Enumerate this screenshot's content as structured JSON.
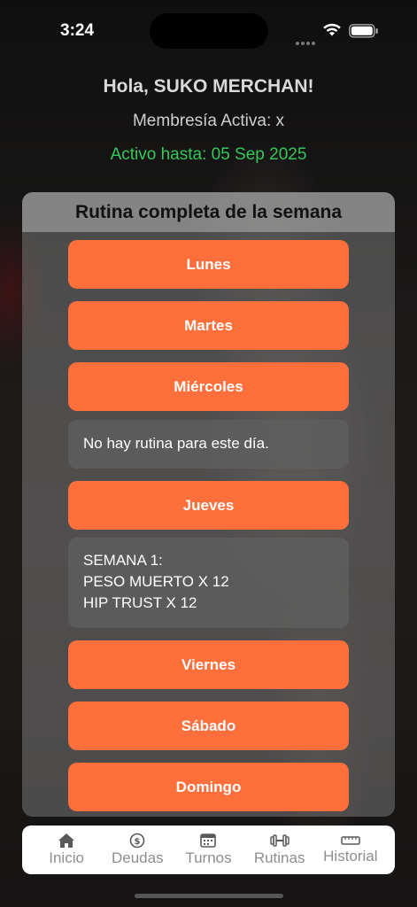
{
  "status_bar": {
    "time": "3:24"
  },
  "header": {
    "greeting": "Hola, SUKO MERCHAN!",
    "membership": "Membresía Activa: x",
    "active_until": "Activo hasta: 05 Sep 2025"
  },
  "routine_panel": {
    "title": "Rutina completa de la semana",
    "days": {
      "monday": "Lunes",
      "tuesday": "Martes",
      "wednesday": "Miércoles",
      "thursday": "Jueves",
      "friday": "Viernes",
      "saturday": "Sábado",
      "sunday": "Domingo"
    },
    "wednesday_routine": "No hay rutina para este día.",
    "thursday_routine": [
      "SEMANA 1:",
      "PESO MUERTO X 12",
      "HIP TRUST X 12"
    ]
  },
  "tab_bar": {
    "items": [
      {
        "label": "Inicio",
        "icon": "house-icon"
      },
      {
        "label": "Deudas",
        "icon": "dollar-circle-icon"
      },
      {
        "label": "Turnos",
        "icon": "calendar-icon"
      },
      {
        "label": "Rutinas",
        "icon": "dumbbell-icon"
      },
      {
        "label": "Historial",
        "icon": "history-icon"
      }
    ]
  },
  "colors": {
    "accent": "#ff6f3c",
    "active_green": "#34c759",
    "tab_inactive": "#8e8e93"
  }
}
